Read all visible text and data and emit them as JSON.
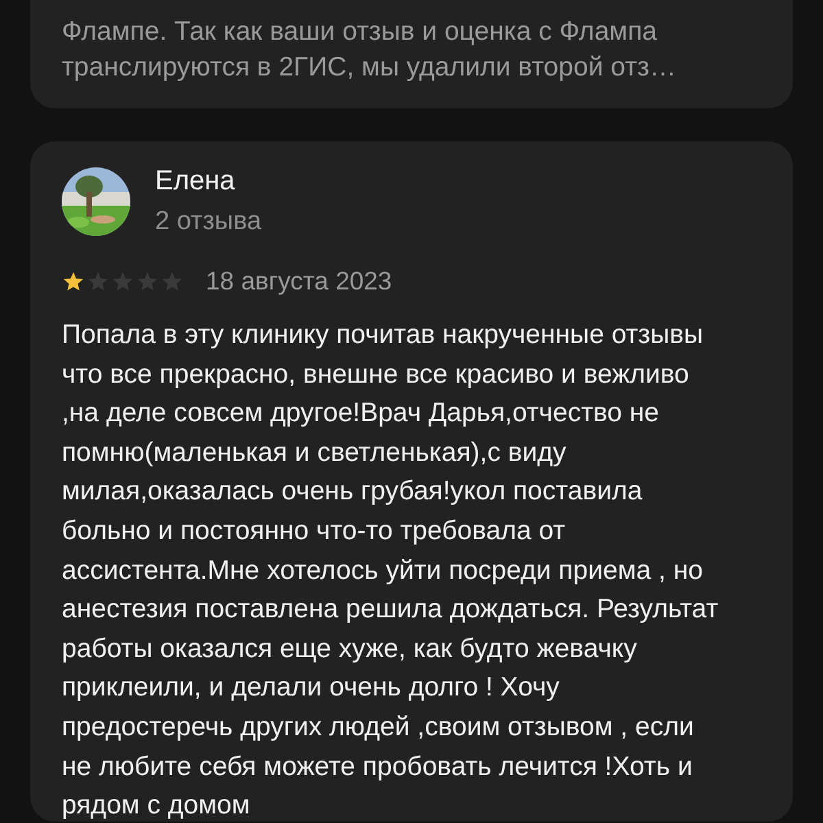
{
  "previous_card": {
    "text": "Флампе. Так как ваши отзыв и оценка с Флампа транслируются в 2ГИС, мы удалили второй отз…"
  },
  "review": {
    "author": "Елена",
    "review_count": "2 отзыва",
    "stars": 1,
    "date": "18 августа 2023",
    "text": "Попала в эту клинику почитав накрученные отзывы что все прекрасно, внешне все красиво и вежливо ,на деле совсем другое!Врач Дарья,отчество не помню(маленькая и светленькая),с виду милая,оказалась очень грубая!укол поставила больно и постоянно что-то требовала от ассистента.Мне хотелось уйти посреди приема , но анестезия поставлена решила дождаться. Результат работы оказался еще хуже, как будто жевачку приклеили, и делали очень долго ! Хочу предостеречь других людей ,своим отзывом , если не любите себя можете пробовать лечится !Хоть и рядом с домом"
  }
}
